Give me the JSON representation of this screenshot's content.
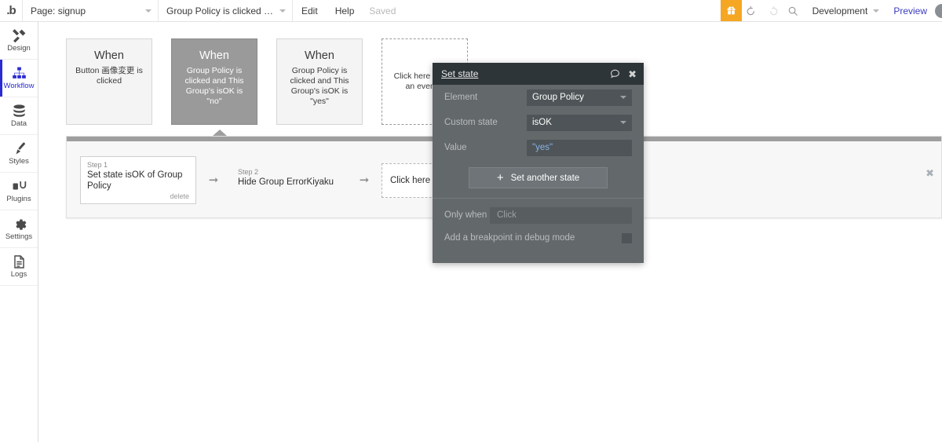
{
  "topbar": {
    "logo": "bubble-logo",
    "page_selector": {
      "label": "Page: signup",
      "icon": "chevron-down-icon"
    },
    "workflow_selector": {
      "label": "Group Policy is clicked and This ...",
      "icon": "chevron-down-icon"
    },
    "edit_label": "Edit",
    "help_label": "Help",
    "saved_label": "Saved",
    "gift_icon": "gift-icon",
    "undo_icon": "undo-icon",
    "redo_icon": "redo-icon",
    "search_icon": "search-icon",
    "version_label": "Development",
    "preview_label": "Preview",
    "avatar": "user-avatar"
  },
  "sidebar": {
    "items": [
      {
        "label": "Design",
        "icon": "design-icon",
        "active": false
      },
      {
        "label": "Workflow",
        "icon": "workflow-icon",
        "active": true
      },
      {
        "label": "Data",
        "icon": "data-icon",
        "active": false
      },
      {
        "label": "Styles",
        "icon": "styles-brush-icon",
        "active": false
      },
      {
        "label": "Plugins",
        "icon": "plugins-icon",
        "active": false
      },
      {
        "label": "Settings",
        "icon": "gear-icon",
        "active": false
      },
      {
        "label": "Logs",
        "icon": "logs-document-icon",
        "active": false
      }
    ],
    "expand_arrow": "expand-right-arrow-icon"
  },
  "canvas": {
    "event_cards": [
      {
        "when": "When",
        "desc": "Button 画像変更 is clicked",
        "selected": false,
        "placeholder": false
      },
      {
        "when": "When",
        "desc": "Group Policy is clicked and This Group's isOK is \"no\"",
        "selected": true,
        "placeholder": false
      },
      {
        "when": "When",
        "desc": "Group Policy is clicked and This Group's isOK is \"yes\"",
        "selected": false,
        "placeholder": false
      },
      {
        "when": "",
        "desc": "Click here to add an event...",
        "selected": false,
        "placeholder": true
      }
    ],
    "steps": [
      {
        "num": "Step 1",
        "title": "Set state isOK of Group Policy",
        "delete_label": "delete"
      },
      {
        "num": "Step 2",
        "title": "Hide Group ErrorKiyaku",
        "delete_label": ""
      }
    ],
    "step_arrow_icon": "arrow-right-icon",
    "add_step_label": "Click here to add an action...",
    "panel_close_icon": "close-icon"
  },
  "modal": {
    "title": "Set state",
    "comment_icon": "comment-bubble-icon",
    "close_icon": "close-icon",
    "fields": [
      {
        "label": "Element",
        "value": "Group Policy",
        "type": "dropdown"
      },
      {
        "label": "Custom state",
        "value": "isOK",
        "type": "dropdown"
      },
      {
        "label": "Value",
        "value": "\"yes\"",
        "type": "expression"
      }
    ],
    "set_another_label": "Set another state",
    "set_another_icon": "plus-icon",
    "only_when_label": "Only when",
    "only_when_placeholder": "Click",
    "breakpoint_label": "Add a breakpoint in debug mode",
    "breakpoint_checked": false
  },
  "colors": {
    "accent_blue": "#2b2bd4",
    "gift_orange": "#f5a623",
    "modal_header": "#2e3538",
    "modal_body": "#63686b",
    "modal_field": "#4e5457",
    "value_blue": "#8ab4e8",
    "selected_card": "#9a9a9a",
    "preview_link": "#3b3bbd"
  }
}
